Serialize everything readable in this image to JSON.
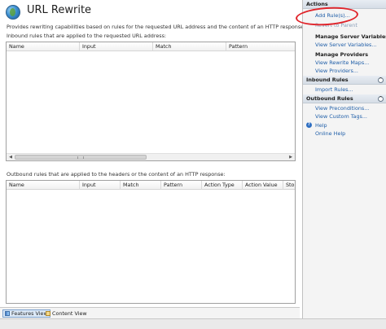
{
  "header": {
    "title": "URL Rewrite",
    "description": "Provides rewriting capabilities based on rules for the requested URL address and the content of an HTTP response."
  },
  "inbound": {
    "label": "Inbound rules that are applied to the requested URL address:",
    "columns": [
      "Name",
      "Input",
      "Match",
      "Pattern"
    ]
  },
  "outbound": {
    "label": "Outbound rules that are applied to the headers or the content of an HTTP response:",
    "columns": [
      "Name",
      "Input",
      "Match",
      "Pattern",
      "Action Type",
      "Action Value",
      "Stop"
    ]
  },
  "views": {
    "features": "Features View",
    "content": "Content View"
  },
  "actions": {
    "title": "Actions",
    "add_rules": "Add Rule(s)...",
    "revert": "Revert to Parent",
    "server_vars_heading": "Manage Server Variables",
    "view_server_vars": "View Server Variables...",
    "providers_heading": "Manage Providers",
    "view_rewrite_maps": "View Rewrite Maps...",
    "view_providers": "View Providers...",
    "inbound_title": "Inbound Rules",
    "import_rules": "Import Rules...",
    "outbound_title": "Outbound Rules",
    "view_preconditions": "View Preconditions...",
    "view_custom_tags": "View Custom Tags...",
    "help": "Help",
    "online_help": "Online Help"
  },
  "colors": {
    "link": "#1f5ea8",
    "highlight": "#e0242a",
    "pane_bg": "#f4f4f4"
  }
}
